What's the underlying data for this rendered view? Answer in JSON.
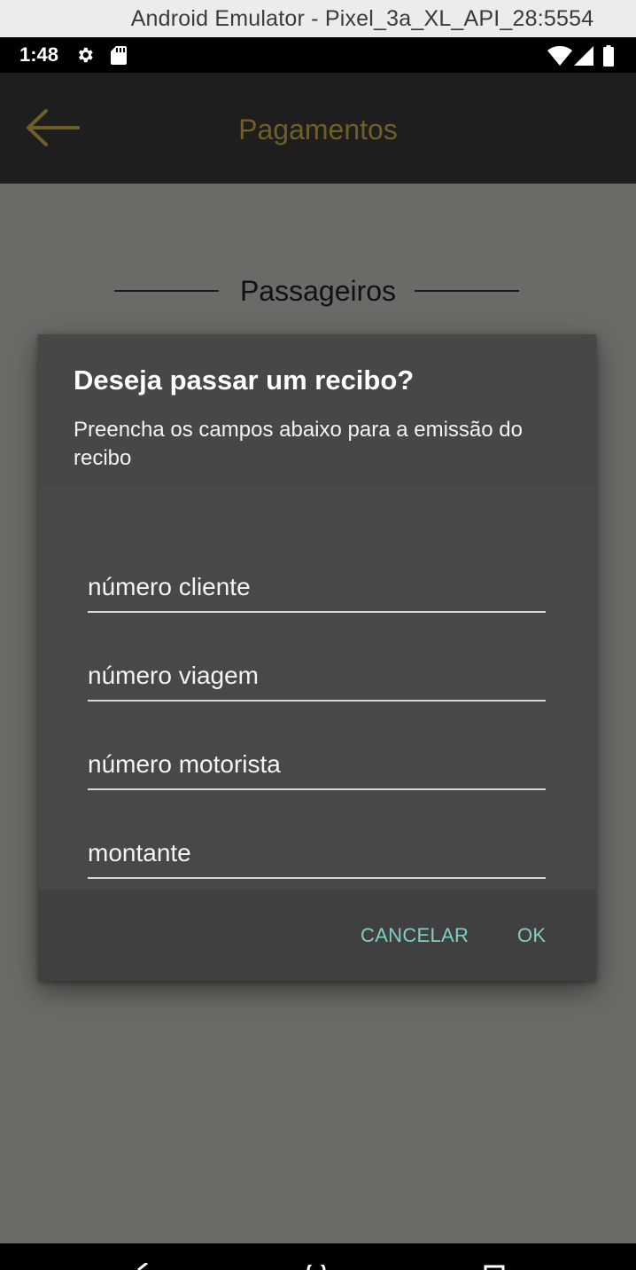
{
  "window": {
    "title": "Android Emulator - Pixel_3a_XL_API_28:5554"
  },
  "status_bar": {
    "time": "1:48",
    "icons": [
      "gear-icon",
      "sd-card-icon",
      "wifi-icon",
      "signal-icon",
      "battery-icon"
    ]
  },
  "toolbar": {
    "title": "Pagamentos",
    "back_icon": "arrow-left-icon"
  },
  "section": {
    "title": "Passageiros"
  },
  "dialog": {
    "title": "Deseja passar um recibo?",
    "message": "Preencha os campos abaixo para a emissão do recibo",
    "fields": [
      {
        "placeholder": "número cliente",
        "value": ""
      },
      {
        "placeholder": "número viagem",
        "value": ""
      },
      {
        "placeholder": "número motorista",
        "value": ""
      },
      {
        "placeholder": "montante",
        "value": ""
      }
    ],
    "cancel_label": "CANCELAR",
    "ok_label": "OK"
  },
  "colors": {
    "accent": "#7fcfc6",
    "toolbar_title": "#6e5f26",
    "dialog_bg": "#484848",
    "scrim_bg": "#6b6a66"
  }
}
